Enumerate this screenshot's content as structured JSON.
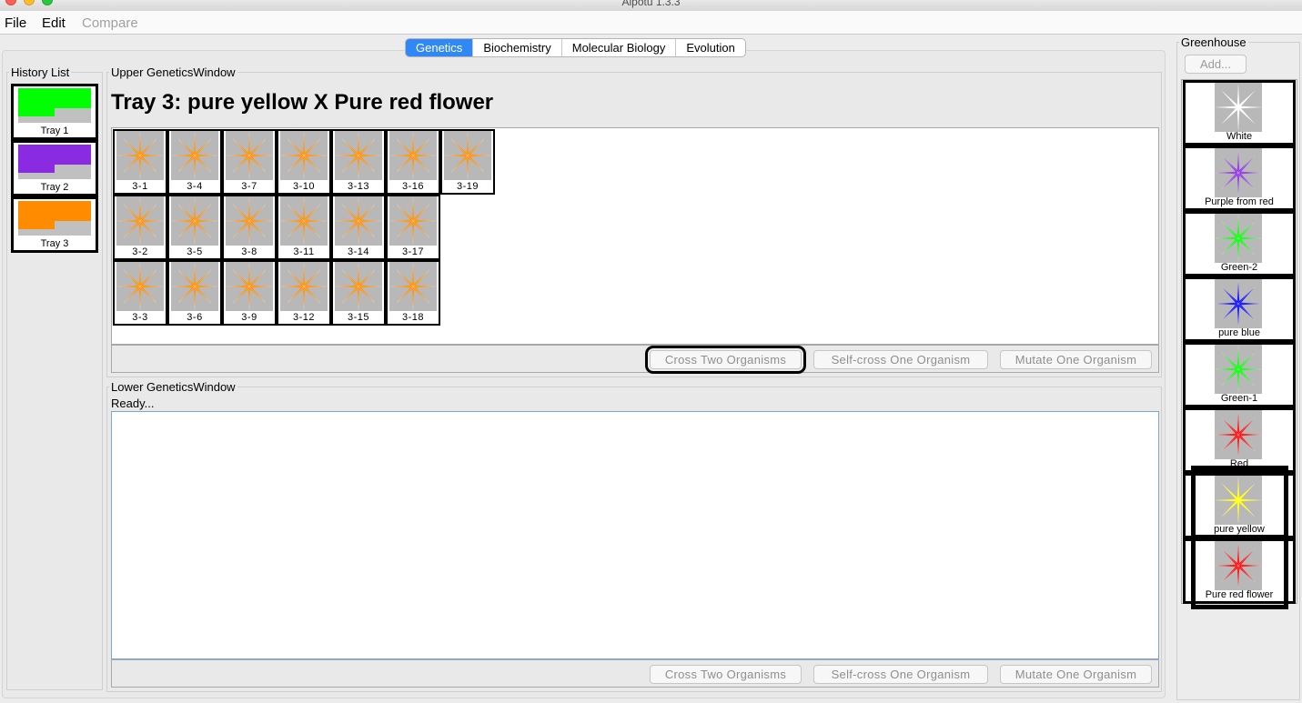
{
  "window": {
    "title": "Aipotu 1.3.3"
  },
  "menubar": {
    "file": "File",
    "edit": "Edit",
    "compare": "Compare"
  },
  "tabs": [
    {
      "label": "Genetics",
      "active": true
    },
    {
      "label": "Biochemistry",
      "active": false
    },
    {
      "label": "Molecular Biology",
      "active": false
    },
    {
      "label": "Evolution",
      "active": false
    }
  ],
  "history": {
    "legend": "History List",
    "items": [
      {
        "label": "Tray 1",
        "color": "#00ff00"
      },
      {
        "label": "Tray 2",
        "color": "#8a2be2"
      },
      {
        "label": "Tray 3",
        "color": "#ff8c00"
      }
    ]
  },
  "upper": {
    "legend": "Upper GeneticsWindow",
    "tray_title": "Tray 3: pure yellow X Pure red flower",
    "flower_color": "#ff8c00",
    "organisms": [
      [
        "3-1",
        "3-4",
        "3-7",
        "3-10",
        "3-13",
        "3-16",
        "3-19"
      ],
      [
        "3-2",
        "3-5",
        "3-8",
        "3-11",
        "3-14",
        "3-17"
      ],
      [
        "3-3",
        "3-6",
        "3-9",
        "3-12",
        "3-15",
        "3-18"
      ]
    ],
    "buttons": {
      "cross": "Cross Two Organisms",
      "self_cross": "Self-cross One Organism",
      "mutate": "Mutate One Organism"
    }
  },
  "lower": {
    "legend": "Lower GeneticsWindow",
    "status": "Ready...",
    "buttons": {
      "cross": "Cross Two Organisms",
      "self_cross": "Self-cross One Organism",
      "mutate": "Mutate One Organism"
    }
  },
  "greenhouse": {
    "legend": "Greenhouse",
    "add_label": "Add...",
    "items": [
      {
        "label": "White",
        "color": "#ffffff"
      },
      {
        "label": "Purple from red",
        "color": "#8a2be2"
      },
      {
        "label": "Green-2",
        "color": "#00ff00"
      },
      {
        "label": "pure blue",
        "color": "#0000ff"
      },
      {
        "label": "Green-1",
        "color": "#00ff00"
      },
      {
        "label": "Red",
        "color": "#ff0000"
      },
      {
        "label": "pure yellow",
        "color": "#ffff00"
      },
      {
        "label": "Pure red flower",
        "color": "#ff0000"
      }
    ]
  }
}
